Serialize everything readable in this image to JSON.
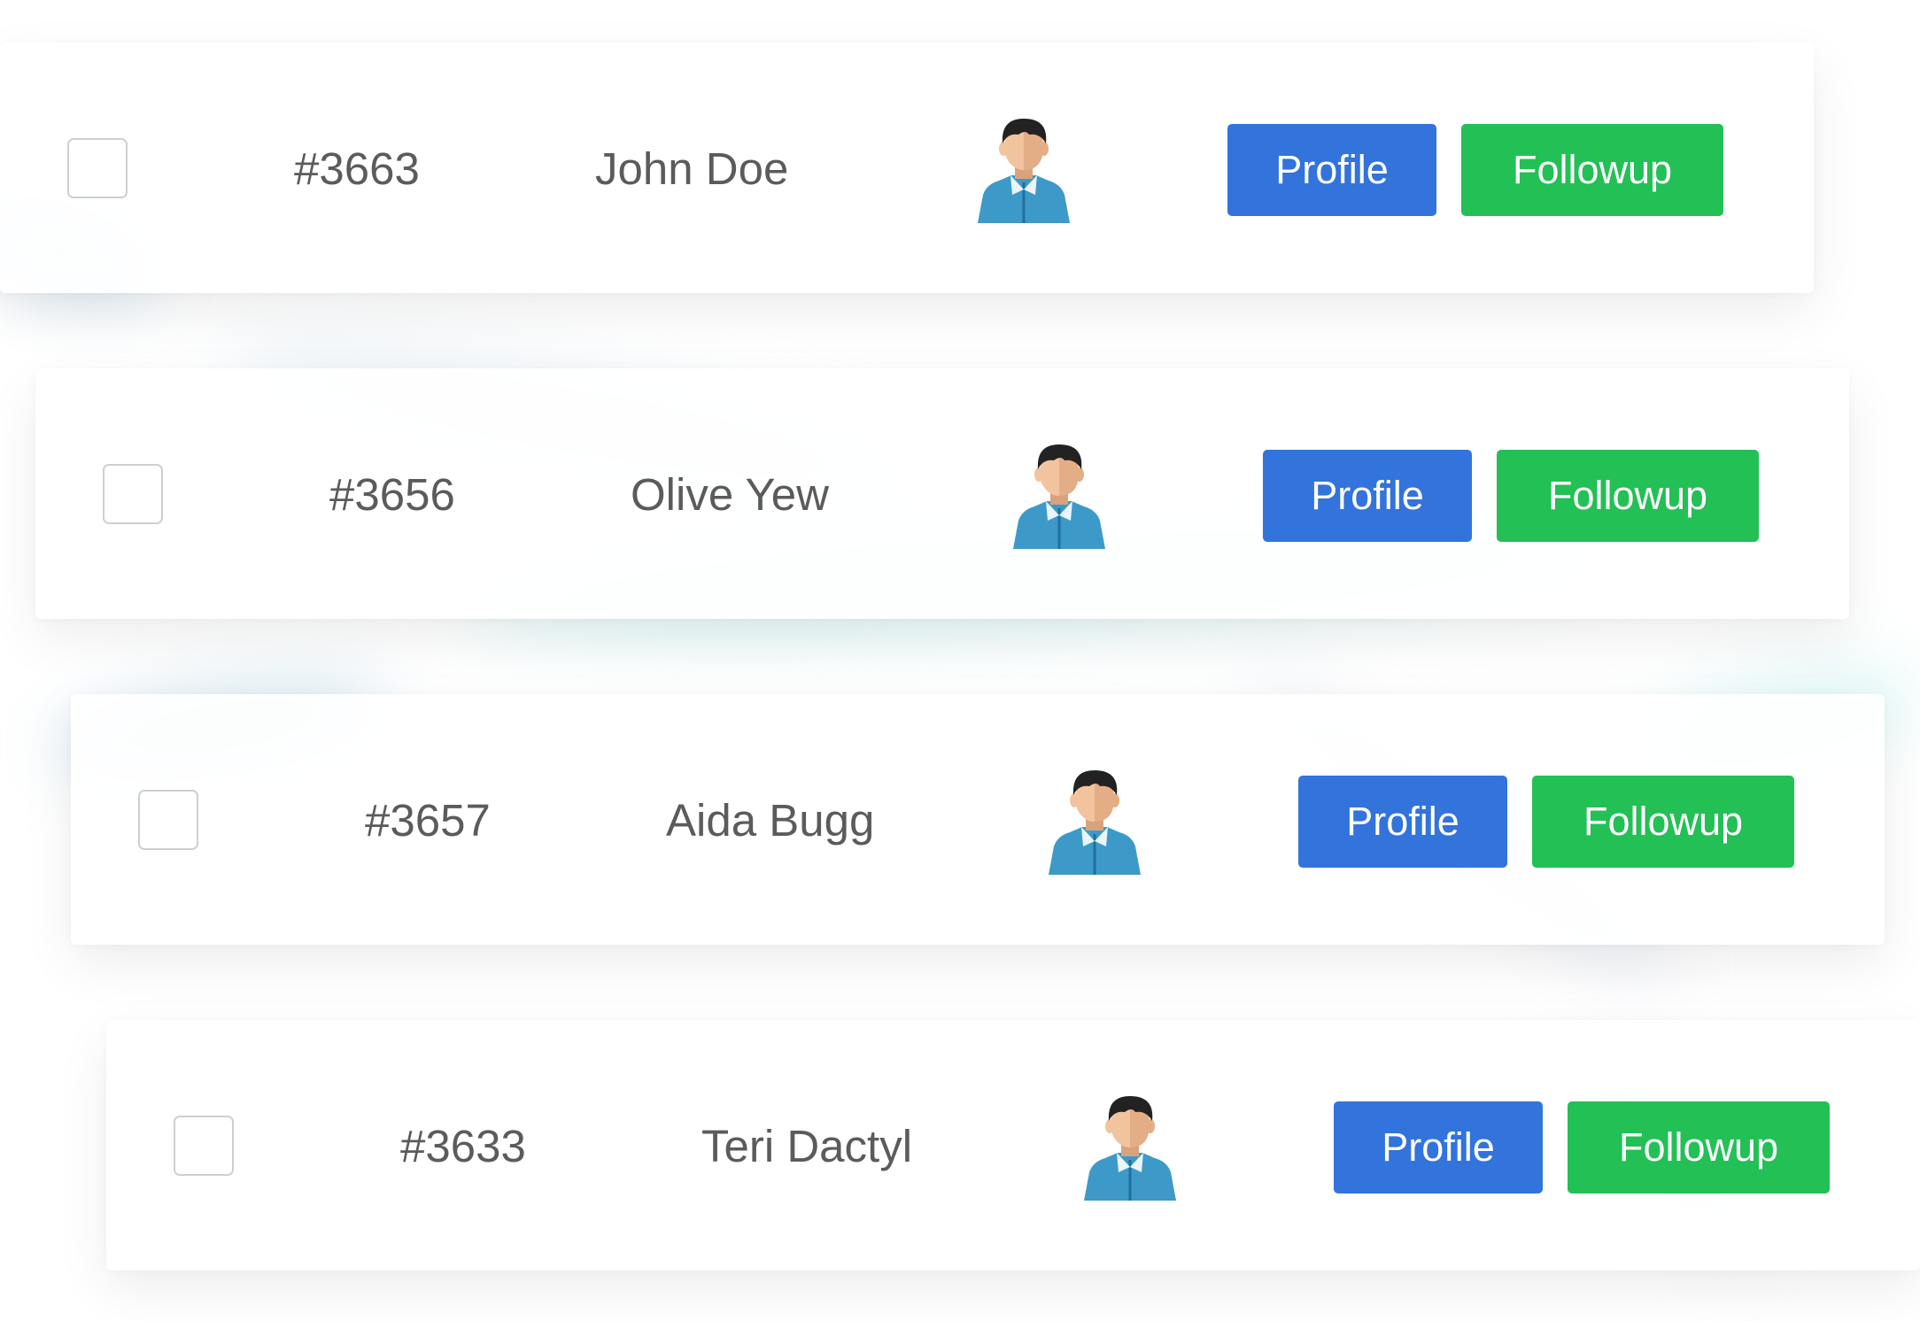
{
  "theme": {
    "profile_button_color": "#3273dc",
    "followup_button_color": "#23c055",
    "text_color": "#5b5b5b"
  },
  "rows": [
    {
      "id": "#3663",
      "name": "John Doe",
      "avatar_icon": "male-user-avatar-icon",
      "profile_label": "Profile",
      "followup_label": "Followup"
    },
    {
      "id": "#3656",
      "name": "Olive Yew",
      "avatar_icon": "male-user-avatar-icon",
      "profile_label": "Profile",
      "followup_label": "Followup"
    },
    {
      "id": "#3657",
      "name": "Aida Bugg",
      "avatar_icon": "male-user-avatar-icon",
      "profile_label": "Profile",
      "followup_label": "Followup"
    },
    {
      "id": "#3633",
      "name": "Teri Dactyl",
      "avatar_icon": "male-user-avatar-icon",
      "profile_label": "Profile",
      "followup_label": "Followup"
    }
  ]
}
